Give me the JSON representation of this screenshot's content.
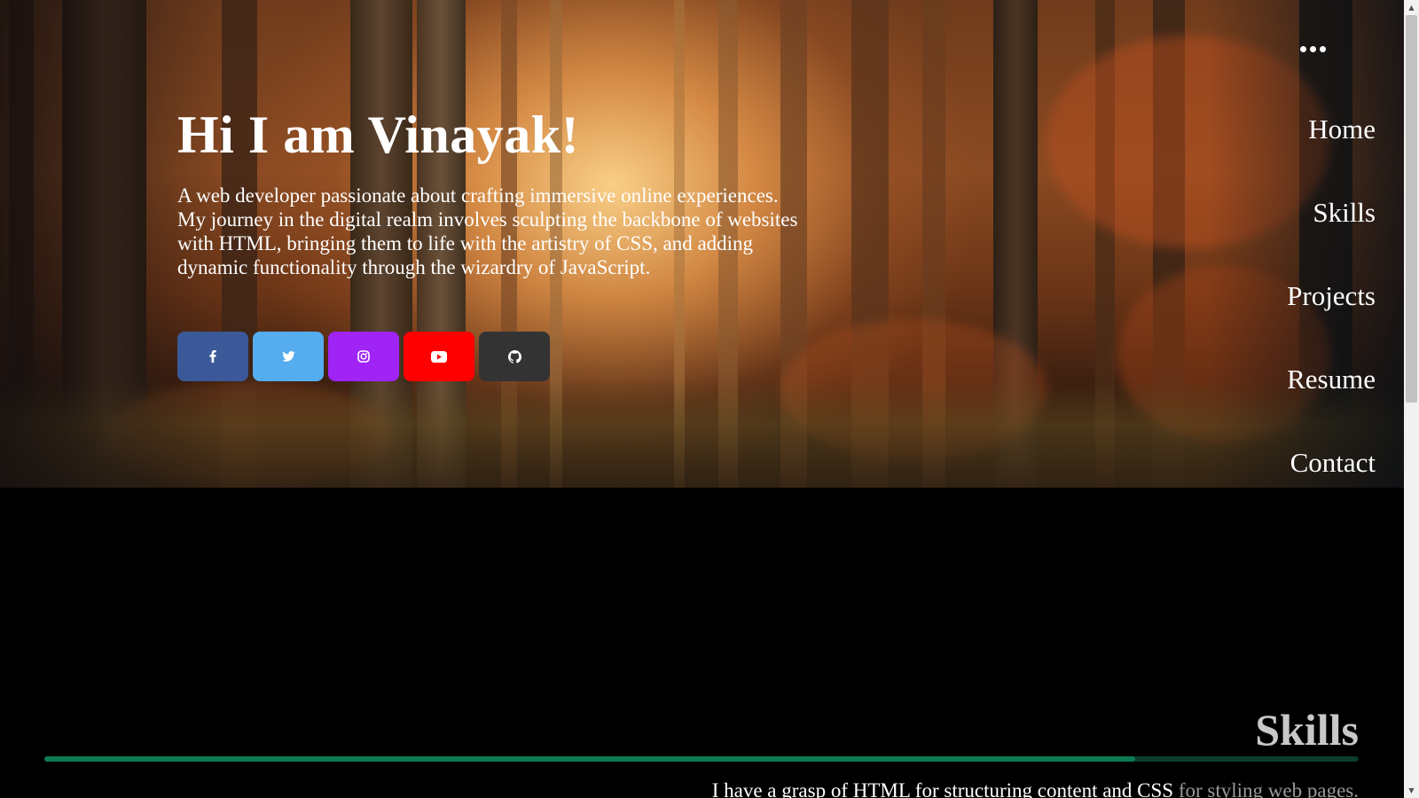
{
  "hero": {
    "title": "Hi I am Vinayak!",
    "description": "A web developer passionate about crafting immersive online experiences. My journey in the digital realm involves sculpting the backbone of websites with HTML, bringing them to life with the artistry of CSS, and adding dynamic functionality through the wizardry of JavaScript.",
    "socials": [
      {
        "name": "facebook",
        "icon": "facebook-icon",
        "color": "#3b5998"
      },
      {
        "name": "twitter",
        "icon": "twitter-icon",
        "color": "#55acee"
      },
      {
        "name": "instagram",
        "icon": "instagram-icon",
        "color": "#a024f5"
      },
      {
        "name": "youtube",
        "icon": "youtube-icon",
        "color": "#ff0000"
      },
      {
        "name": "github",
        "icon": "github-icon",
        "color": "#333333"
      }
    ]
  },
  "nav": {
    "menu_icon": "more-horizontal-icon",
    "items": [
      {
        "label": "Home"
      },
      {
        "label": "Skills"
      },
      {
        "label": "Projects"
      },
      {
        "label": "Resume"
      },
      {
        "label": "Contact"
      }
    ]
  },
  "skills": {
    "title": "Skills",
    "progress": 0.83,
    "text_main": "I have a grasp of HTML for structuring content and CSS",
    "text_dim": " for styling web pages."
  },
  "colors": {
    "accent": "#0f7a52",
    "background": "#000000"
  }
}
